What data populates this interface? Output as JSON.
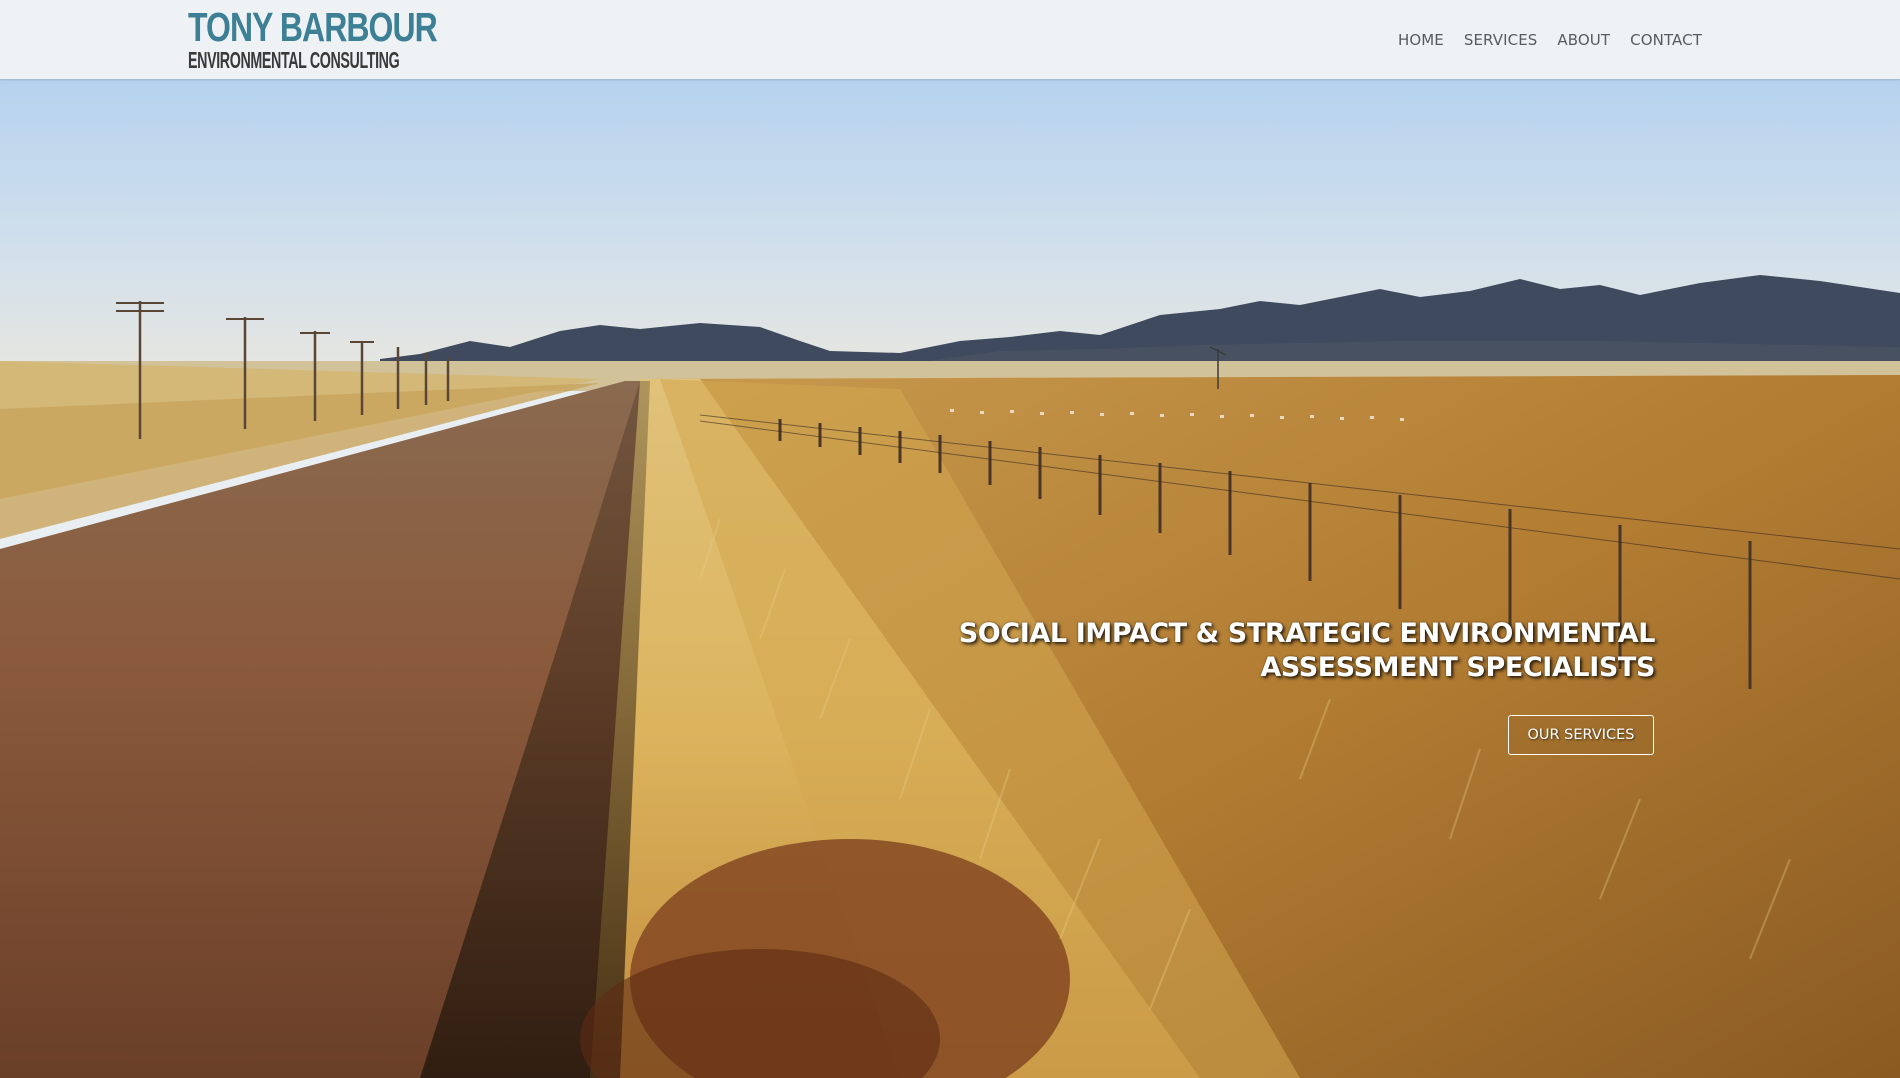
{
  "logo": {
    "line1": "TONY BARBOUR",
    "line2": "ENVIRONMENTAL CONSULTING"
  },
  "nav": {
    "items": [
      "HOME",
      "SERVICES",
      "ABOUT",
      "CONTACT"
    ]
  },
  "hero": {
    "headline_line1": "SOCIAL IMPACT & STRATEGIC ENVIRONMENTAL",
    "headline_line2": "ASSESSMENT SPECIALISTS",
    "cta_label": "OUR SERVICES"
  },
  "colors": {
    "brand_teal": "#3d7f95",
    "header_bg": "#eef2f5",
    "nav_text": "#565b60"
  }
}
